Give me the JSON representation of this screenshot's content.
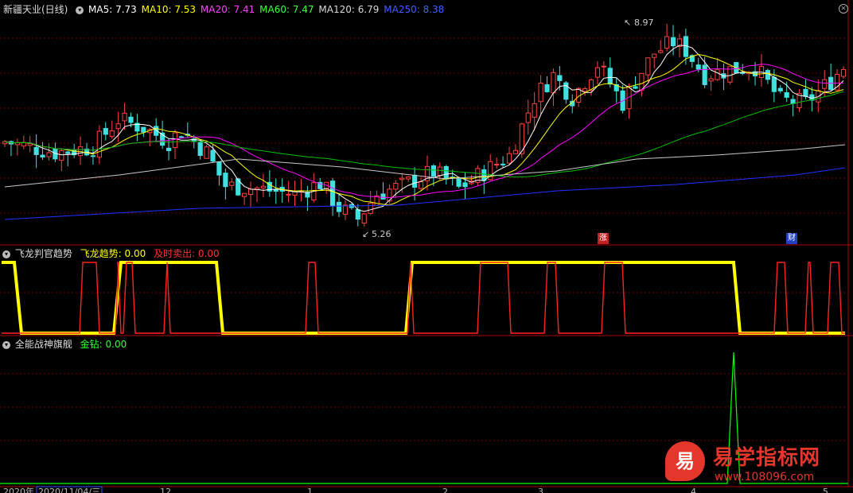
{
  "main_panel": {
    "stock_title": "新疆天业(日线)",
    "ma5": "MA5: 7.73",
    "ma10": "MA10: 7.53",
    "ma20": "MA20: 7.41",
    "ma60": "MA60: 7.47",
    "ma120": "MA120: 6.79",
    "ma250": "MA250: 8.38",
    "high_label": "8.97",
    "low_label": "5.26",
    "tag_zhang": "涨",
    "tag_cai": "财",
    "colors": {
      "ma5": "#ffffff",
      "ma10": "#ffff00",
      "ma20": "#ff00ff",
      "ma60": "#00ff00",
      "ma120": "#d0d0d0",
      "ma250": "#3040ff",
      "up": "#ff4040",
      "down": "#40e0e0"
    }
  },
  "indicator1": {
    "name": "飞龙判官趋势",
    "trend_label": "飞龙趋势: 0.00",
    "sell_label": "及时卖出: 0.00",
    "colors": {
      "trend": "#ffff00",
      "sell": "#ff2020"
    }
  },
  "indicator2": {
    "name": "全能战神旗舰",
    "gold_label": "金钻: 0.00",
    "colors": {
      "gold": "#00ff00"
    }
  },
  "date_axis": {
    "labels": [
      "2020年",
      "2020/11/04/三",
      "12",
      "1",
      "2",
      "3",
      "4",
      "5"
    ]
  },
  "watermark": {
    "logo_char": "易",
    "site_name": "易学指标网",
    "url": "www.108096.com"
  }
}
